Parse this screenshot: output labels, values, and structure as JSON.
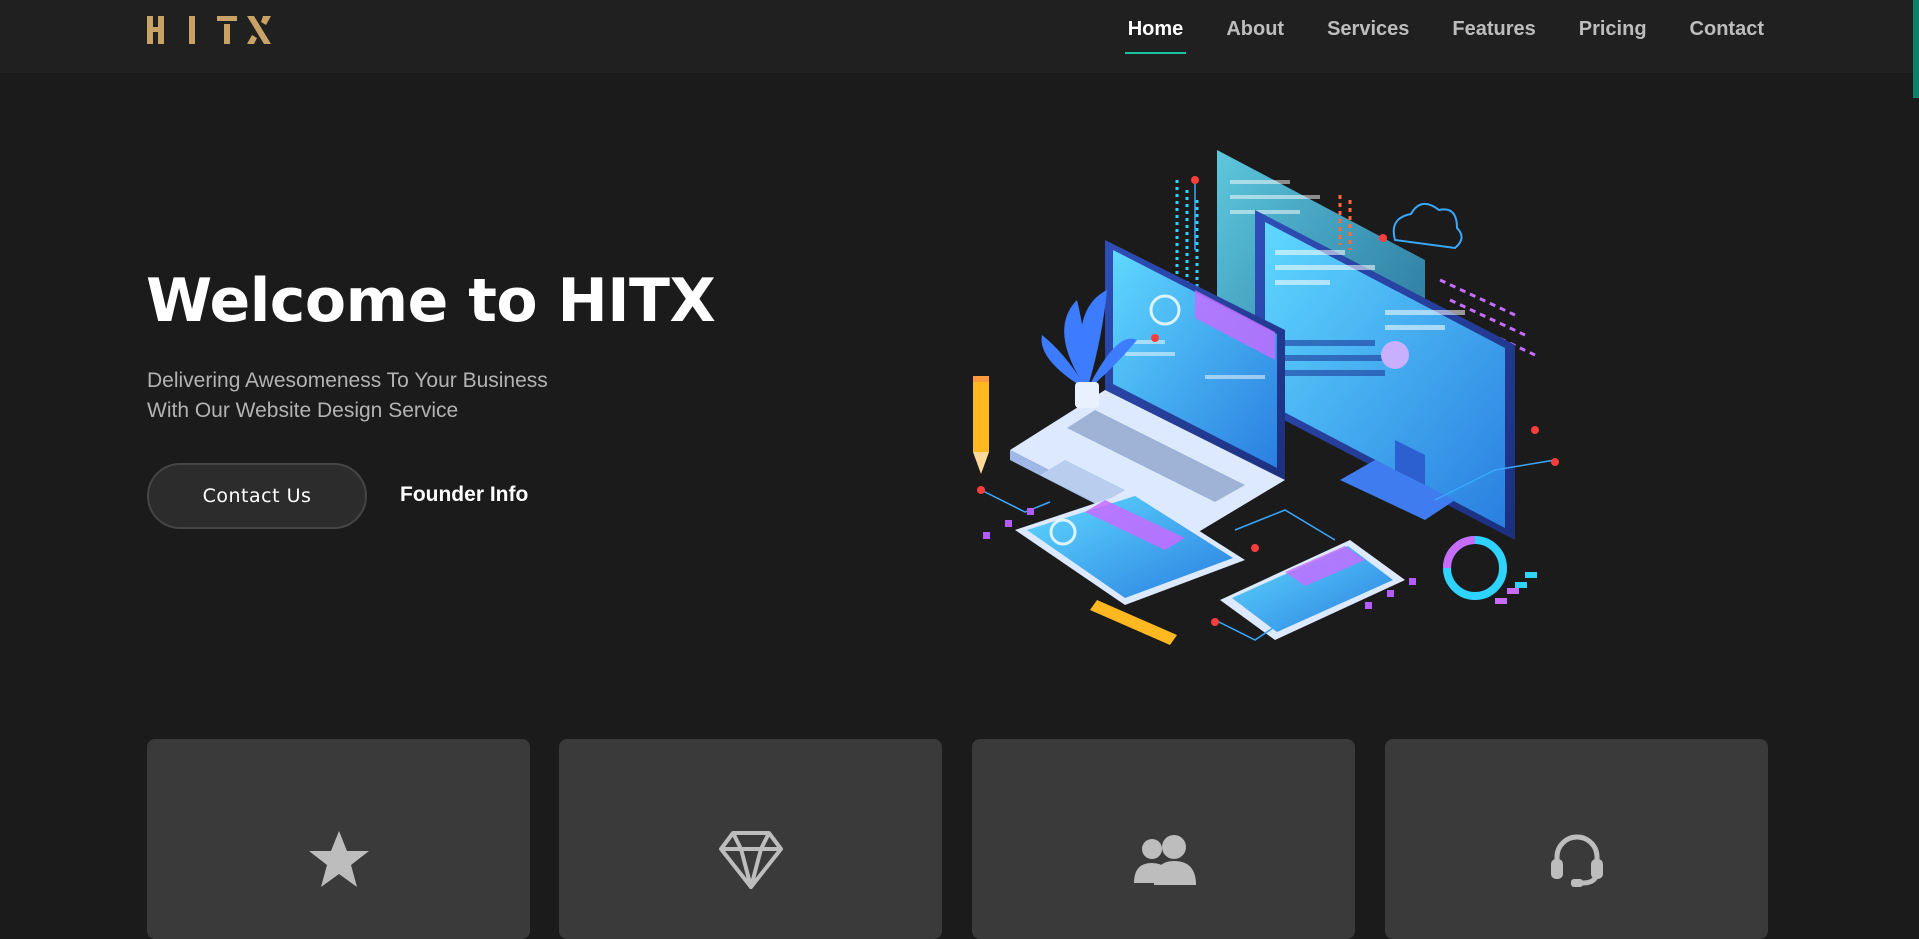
{
  "brand": {
    "logo_text": "HITX",
    "logo_color": "#c9a265"
  },
  "nav": {
    "items": [
      {
        "label": "Home",
        "active": true
      },
      {
        "label": "About",
        "active": false
      },
      {
        "label": "Services",
        "active": false
      },
      {
        "label": "Features",
        "active": false
      },
      {
        "label": "Pricing",
        "active": false
      },
      {
        "label": "Contact",
        "active": false
      }
    ],
    "active_underline_color": "#18c3a0"
  },
  "hero": {
    "title": "Welcome to HITX",
    "subtitle_line1": "Delivering Awesomeness To Your Business",
    "subtitle_line2": "With Our Website Design Service",
    "primary_button": "Contact Us",
    "secondary_link": "Founder Info",
    "illustration_icon": "isometric-devices-illustration"
  },
  "features": {
    "cards": [
      {
        "icon": "star-icon"
      },
      {
        "icon": "diamond-icon"
      },
      {
        "icon": "users-icon"
      },
      {
        "icon": "headset-icon"
      }
    ]
  },
  "colors": {
    "background": "#1b1b1c",
    "header": "#202021",
    "card": "#3a3a3b",
    "icon": "#bdbdbd",
    "accent": "#18c3a0"
  }
}
